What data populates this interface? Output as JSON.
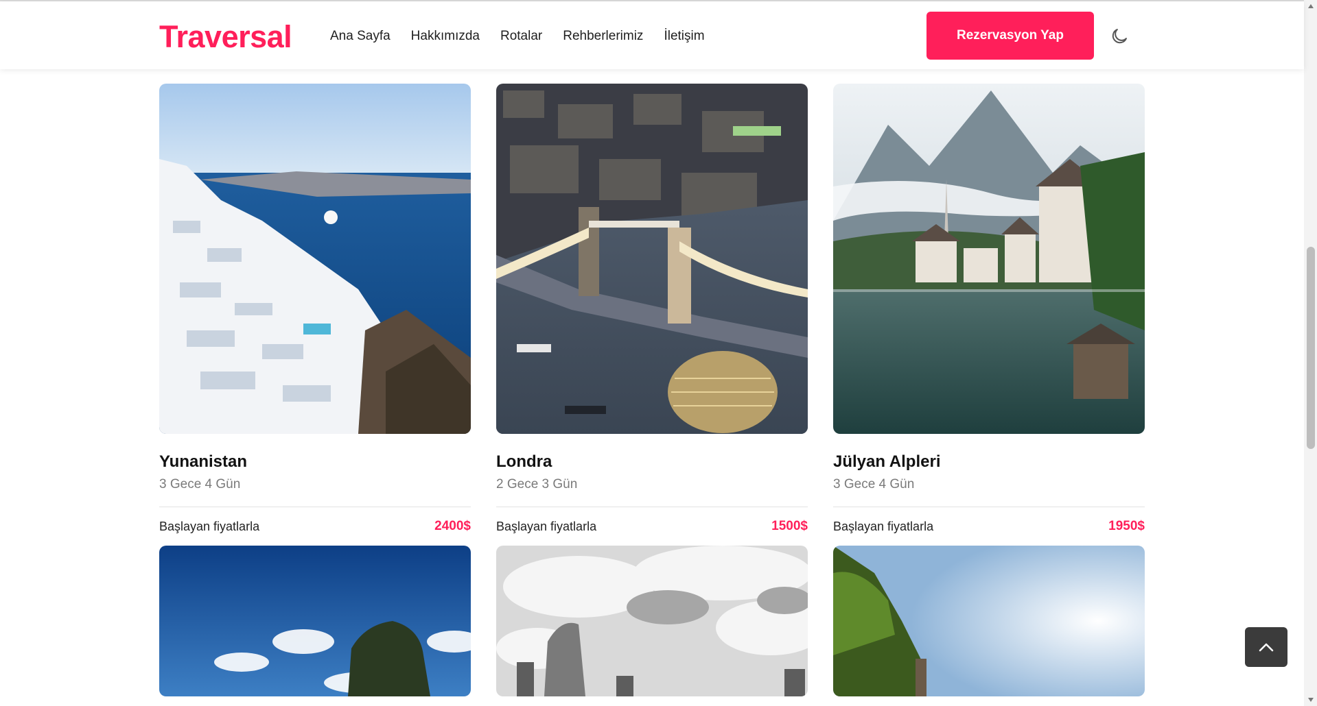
{
  "brand": {
    "name": "Traversal",
    "accent": "#ff1f5a"
  },
  "nav": {
    "items": [
      {
        "label": "Ana Sayfa"
      },
      {
        "label": "Hakkımızda"
      },
      {
        "label": "Rotalar"
      },
      {
        "label": "Rehberlerimiz"
      },
      {
        "label": "İletişim"
      }
    ]
  },
  "header": {
    "cta_label": "Rezervasyon Yap",
    "theme_icon": "moon-icon"
  },
  "tours": [
    {
      "title": "Yunanistan",
      "duration": "3 Gece 4 Gün",
      "price_label": "Başlayan fiyatlarla",
      "price": "2400$"
    },
    {
      "title": "Londra",
      "duration": "2 Gece 3 Gün",
      "price_label": "Başlayan fiyatlarla",
      "price": "1500$"
    },
    {
      "title": "Jülyan Alpleri",
      "duration": "3 Gece 4 Gün",
      "price_label": "Başlayan fiyatlarla",
      "price": "1950$"
    }
  ],
  "scroll_top_icon": "chevron-up-icon"
}
